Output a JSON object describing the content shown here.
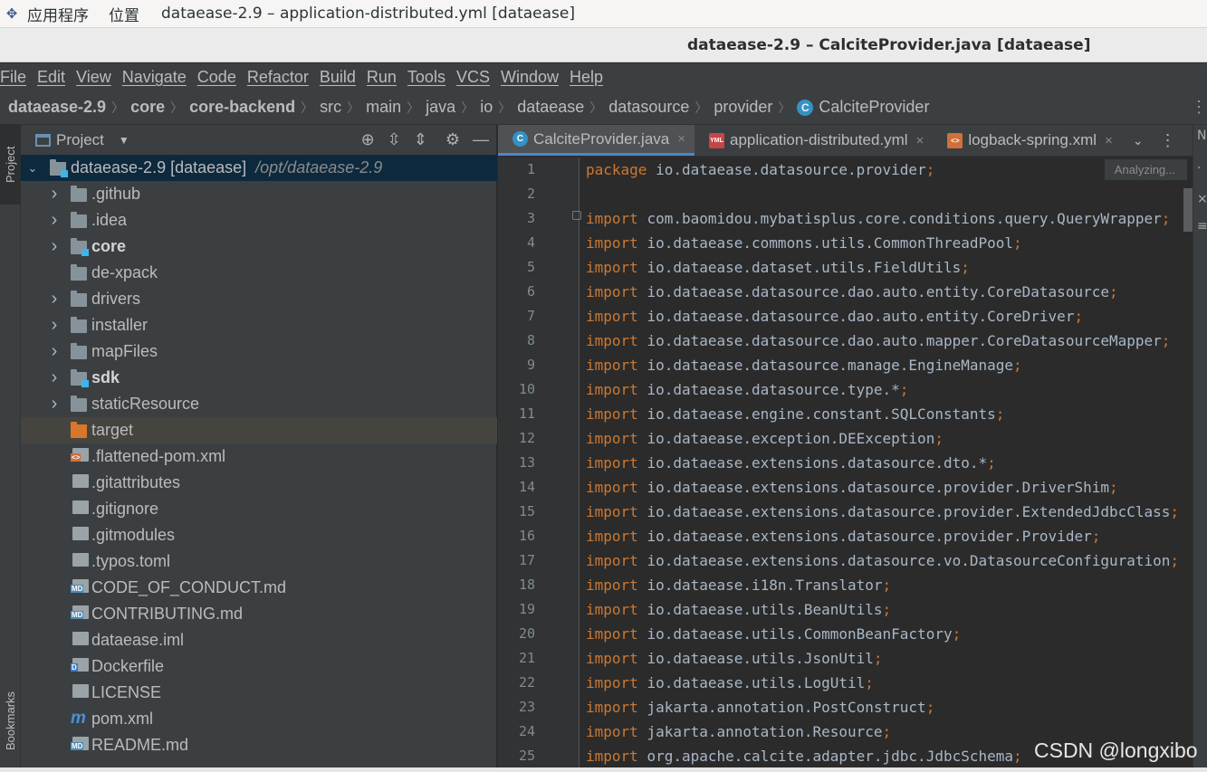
{
  "system": {
    "items": [
      "应用程序",
      "位置"
    ],
    "active_window": "dataease-2.9 – application-distributed.yml [dataease]"
  },
  "window": {
    "title": "dataease-2.9 – CalciteProvider.java [dataease]"
  },
  "menu": [
    "File",
    "Edit",
    "View",
    "Navigate",
    "Code",
    "Refactor",
    "Build",
    "Run",
    "Tools",
    "VCS",
    "Window",
    "Help"
  ],
  "breadcrumb": [
    "dataease-2.9",
    "core",
    "core-backend",
    "src",
    "main",
    "java",
    "io",
    "dataease",
    "datasource",
    "provider",
    "CalciteProvider"
  ],
  "left_strip": {
    "project_tab": "Project",
    "bookmarks_tab": "Bookmarks"
  },
  "project": {
    "title": "Project",
    "root": {
      "name": "dataease-2.9 [dataease]",
      "path": "/opt/dataease-2.9"
    },
    "items": [
      {
        "name": ".github",
        "type": "folder"
      },
      {
        "name": ".idea",
        "type": "folder"
      },
      {
        "name": "core",
        "type": "module"
      },
      {
        "name": "de-xpack",
        "type": "folder"
      },
      {
        "name": "drivers",
        "type": "folder"
      },
      {
        "name": "installer",
        "type": "folder"
      },
      {
        "name": "mapFiles",
        "type": "folder"
      },
      {
        "name": "sdk",
        "type": "module"
      },
      {
        "name": "staticResource",
        "type": "folder"
      },
      {
        "name": "target",
        "type": "excluded"
      },
      {
        "name": ".flattened-pom.xml",
        "type": "xml"
      },
      {
        "name": ".gitattributes",
        "type": "file"
      },
      {
        "name": ".gitignore",
        "type": "file"
      },
      {
        "name": ".gitmodules",
        "type": "file"
      },
      {
        "name": ".typos.toml",
        "type": "file"
      },
      {
        "name": "CODE_OF_CONDUCT.md",
        "type": "md"
      },
      {
        "name": "CONTRIBUTING.md",
        "type": "md"
      },
      {
        "name": "dataease.iml",
        "type": "file"
      },
      {
        "name": "Dockerfile",
        "type": "docker"
      },
      {
        "name": "LICENSE",
        "type": "file"
      },
      {
        "name": "pom.xml",
        "type": "maven"
      },
      {
        "name": "README.md",
        "type": "md"
      }
    ]
  },
  "tabs": [
    {
      "label": "CalciteProvider.java",
      "icon": "java-class-icon",
      "active": true
    },
    {
      "label": "application-distributed.yml",
      "icon": "yml-file-icon",
      "active": false
    },
    {
      "label": "logback-spring.xml",
      "icon": "xml-file-icon",
      "active": false
    }
  ],
  "editor": {
    "status": "Analyzing...",
    "lines": [
      {
        "n": "1",
        "kw": "package",
        "body": "io.dataease.datasource.provider"
      },
      {
        "n": "2",
        "kw": "",
        "body": ""
      },
      {
        "n": "3",
        "kw": "import",
        "body": "com.baomidou.mybatisplus.core.conditions.query.QueryWrapper"
      },
      {
        "n": "4",
        "kw": "import",
        "body": "io.dataease.commons.utils.CommonThreadPool"
      },
      {
        "n": "5",
        "kw": "import",
        "body": "io.dataease.dataset.utils.FieldUtils"
      },
      {
        "n": "6",
        "kw": "import",
        "body": "io.dataease.datasource.dao.auto.entity.CoreDatasource"
      },
      {
        "n": "7",
        "kw": "import",
        "body": "io.dataease.datasource.dao.auto.entity.CoreDriver"
      },
      {
        "n": "8",
        "kw": "import",
        "body": "io.dataease.datasource.dao.auto.mapper.CoreDatasourceMapper"
      },
      {
        "n": "9",
        "kw": "import",
        "body": "io.dataease.datasource.manage.EngineManage"
      },
      {
        "n": "10",
        "kw": "import",
        "body": "io.dataease.datasource.type.*"
      },
      {
        "n": "11",
        "kw": "import",
        "body": "io.dataease.engine.constant.SQLConstants"
      },
      {
        "n": "12",
        "kw": "import",
        "body": "io.dataease.exception.DEException"
      },
      {
        "n": "13",
        "kw": "import",
        "body": "io.dataease.extensions.datasource.dto.*"
      },
      {
        "n": "14",
        "kw": "import",
        "body": "io.dataease.extensions.datasource.provider.DriverShim"
      },
      {
        "n": "15",
        "kw": "import",
        "body": "io.dataease.extensions.datasource.provider.ExtendedJdbcClass"
      },
      {
        "n": "16",
        "kw": "import",
        "body": "io.dataease.extensions.datasource.provider.Provider"
      },
      {
        "n": "17",
        "kw": "import",
        "body": "io.dataease.extensions.datasource.vo.DatasourceConfiguration"
      },
      {
        "n": "18",
        "kw": "import",
        "body": "io.dataease.i18n.Translator"
      },
      {
        "n": "19",
        "kw": "import",
        "body": "io.dataease.utils.BeanUtils"
      },
      {
        "n": "20",
        "kw": "import",
        "body": "io.dataease.utils.CommonBeanFactory"
      },
      {
        "n": "21",
        "kw": "import",
        "body": "io.dataease.utils.JsonUtil"
      },
      {
        "n": "22",
        "kw": "import",
        "body": "io.dataease.utils.LogUtil"
      },
      {
        "n": "23",
        "kw": "import",
        "body": "jakarta.annotation.PostConstruct"
      },
      {
        "n": "24",
        "kw": "import",
        "body": "jakarta.annotation.Resource"
      },
      {
        "n": "25",
        "kw": "import",
        "body": "org.apache.calcite.adapter.jdbc.JdbcSchema"
      }
    ]
  },
  "watermark": "CSDN @longxibo",
  "colors": {
    "keyword": "#cc7832",
    "code": "#a9b7c6",
    "editor_bg": "#2b2b2b",
    "panel_bg": "#3c3f41",
    "accent": "#4a88c7"
  }
}
